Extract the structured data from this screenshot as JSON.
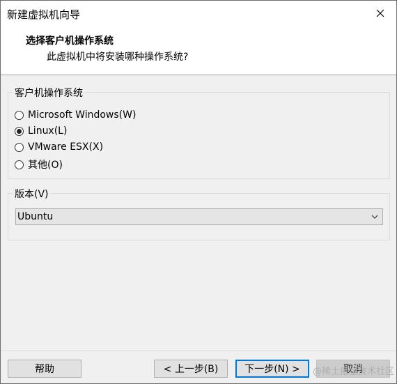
{
  "window": {
    "title": "新建虚拟机向导"
  },
  "header": {
    "title": "选择客户机操作系统",
    "subtitle": "此虚拟机中将安装哪种操作系统?"
  },
  "guest_os": {
    "group_label": "客户机操作系统",
    "options": [
      {
        "label": "Microsoft Windows(W)",
        "checked": false
      },
      {
        "label": "Linux(L)",
        "checked": true
      },
      {
        "label": "VMware ESX(X)",
        "checked": false
      },
      {
        "label": "其他(O)",
        "checked": false
      }
    ]
  },
  "version": {
    "group_label": "版本(V)",
    "selected": "Ubuntu"
  },
  "footer": {
    "help": "帮助",
    "back": "< 上一步(B)",
    "next": "下一步(N) >",
    "cancel": "取消"
  },
  "watermark": "@稀土掘金技术社区",
  "icons": {
    "close": "close-icon",
    "dropdown": "chevron-down-icon"
  }
}
